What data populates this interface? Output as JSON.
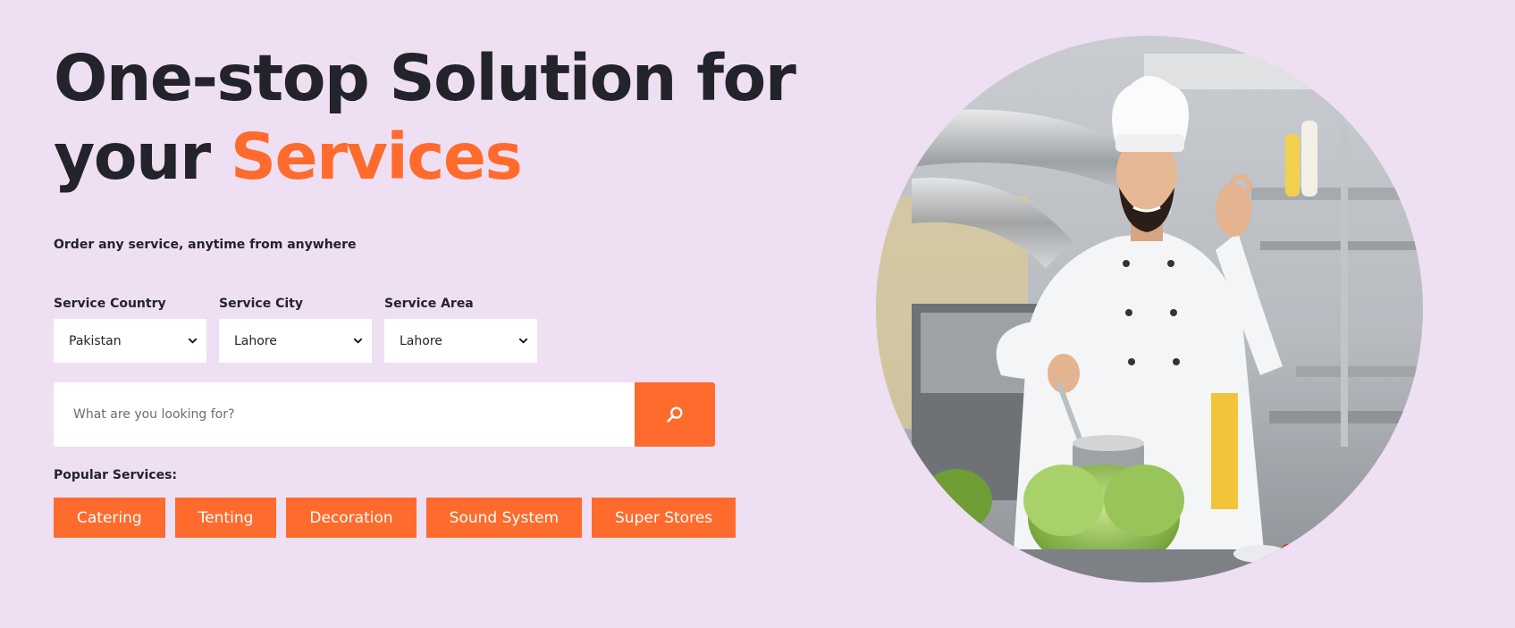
{
  "hero": {
    "headline_part1": "One-stop Solution for",
    "headline_part2": "your",
    "headline_accent": "Services",
    "tagline": "Order any service, anytime from anywhere"
  },
  "filters": {
    "country_label": "Service Country",
    "country_value": "Pakistan",
    "city_label": "Service City",
    "city_value": "Lahore",
    "area_label": "Service Area",
    "area_value": "Lahore"
  },
  "search": {
    "placeholder": "What are you looking for?",
    "icon": "search-icon"
  },
  "popular": {
    "label": "Popular Services:",
    "items": [
      "Catering",
      "Tenting",
      "Decoration",
      "Sound System",
      "Super Stores"
    ]
  },
  "image": {
    "subject": "chef-in-kitchen"
  },
  "colors": {
    "background": "#efdff3",
    "accent": "#ff6b2c",
    "text": "#23232b"
  }
}
